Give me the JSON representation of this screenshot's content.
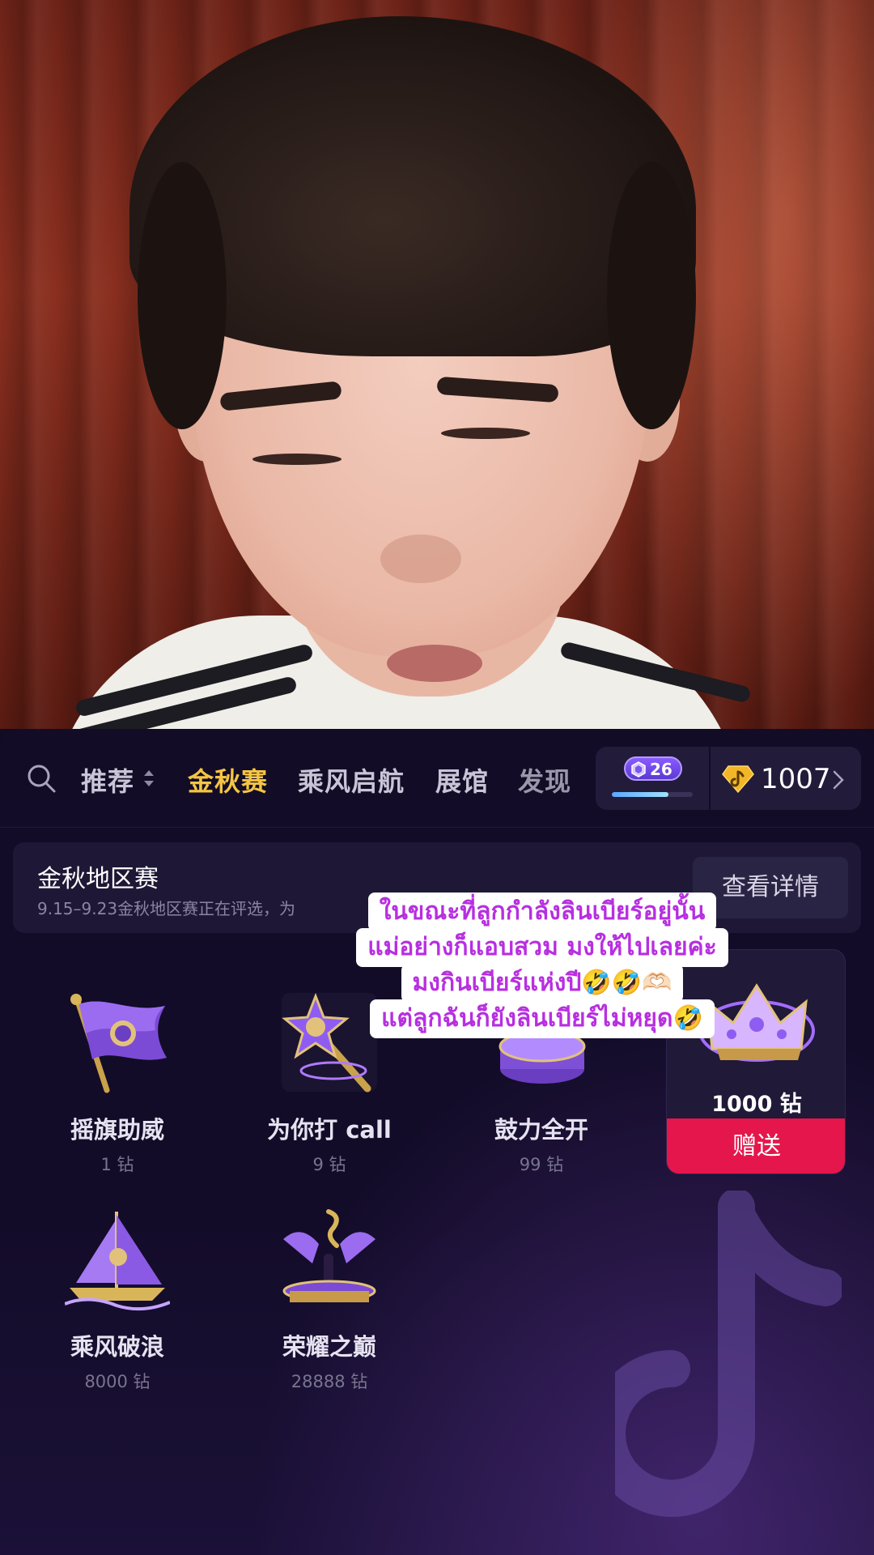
{
  "tabs": [
    {
      "label": "推荐",
      "active": false
    },
    {
      "label": "金秋赛",
      "active": true
    },
    {
      "label": "乘风启航",
      "active": false
    },
    {
      "label": "展馆",
      "active": false
    },
    {
      "label": "发现",
      "active": false
    }
  ],
  "level": {
    "value": "26",
    "progress": 0.7
  },
  "coins": {
    "amount": "1007"
  },
  "banner": {
    "title": "金秋地区赛",
    "subtitle": "9.15–9.23金秋地区赛正在评选，为",
    "button": "查看详情"
  },
  "gifts": [
    {
      "name": "摇旗助威",
      "price": "1 钻",
      "icon": "flag-gift-icon"
    },
    {
      "name": "为你打 call",
      "price": "9 钻",
      "icon": "star-wand-gift-icon"
    },
    {
      "name": "鼓力全开",
      "price": "99 钻",
      "icon": "drum-gift-icon"
    },
    {
      "name": "乘风破浪",
      "price": "8000 钻",
      "icon": "sailboat-gift-icon"
    },
    {
      "name": "荣耀之巅",
      "price": "28888 钻",
      "icon": "stage-gift-icon"
    }
  ],
  "selected_gift": {
    "price": "1000 钻",
    "send": "赠送",
    "icon": "crown-gift-icon"
  },
  "caption": [
    "ในขณะที่ลูกกำลังลินเบียร์อยู่นั้น",
    "แม่อย่างก็แอบสวม มงให้ไปเลยค่ะ",
    "มงกินเบียร์แห่งปี🤣🤣🫶🏻",
    "แต่ลูกฉันก็ยังลินเบียร์ไม่หยุด🤣"
  ],
  "colors": {
    "accent_tab": "#f5c542",
    "send_button": "#e5164b",
    "caption_text": "#b72fe0",
    "panel_bg": "#120c27"
  }
}
